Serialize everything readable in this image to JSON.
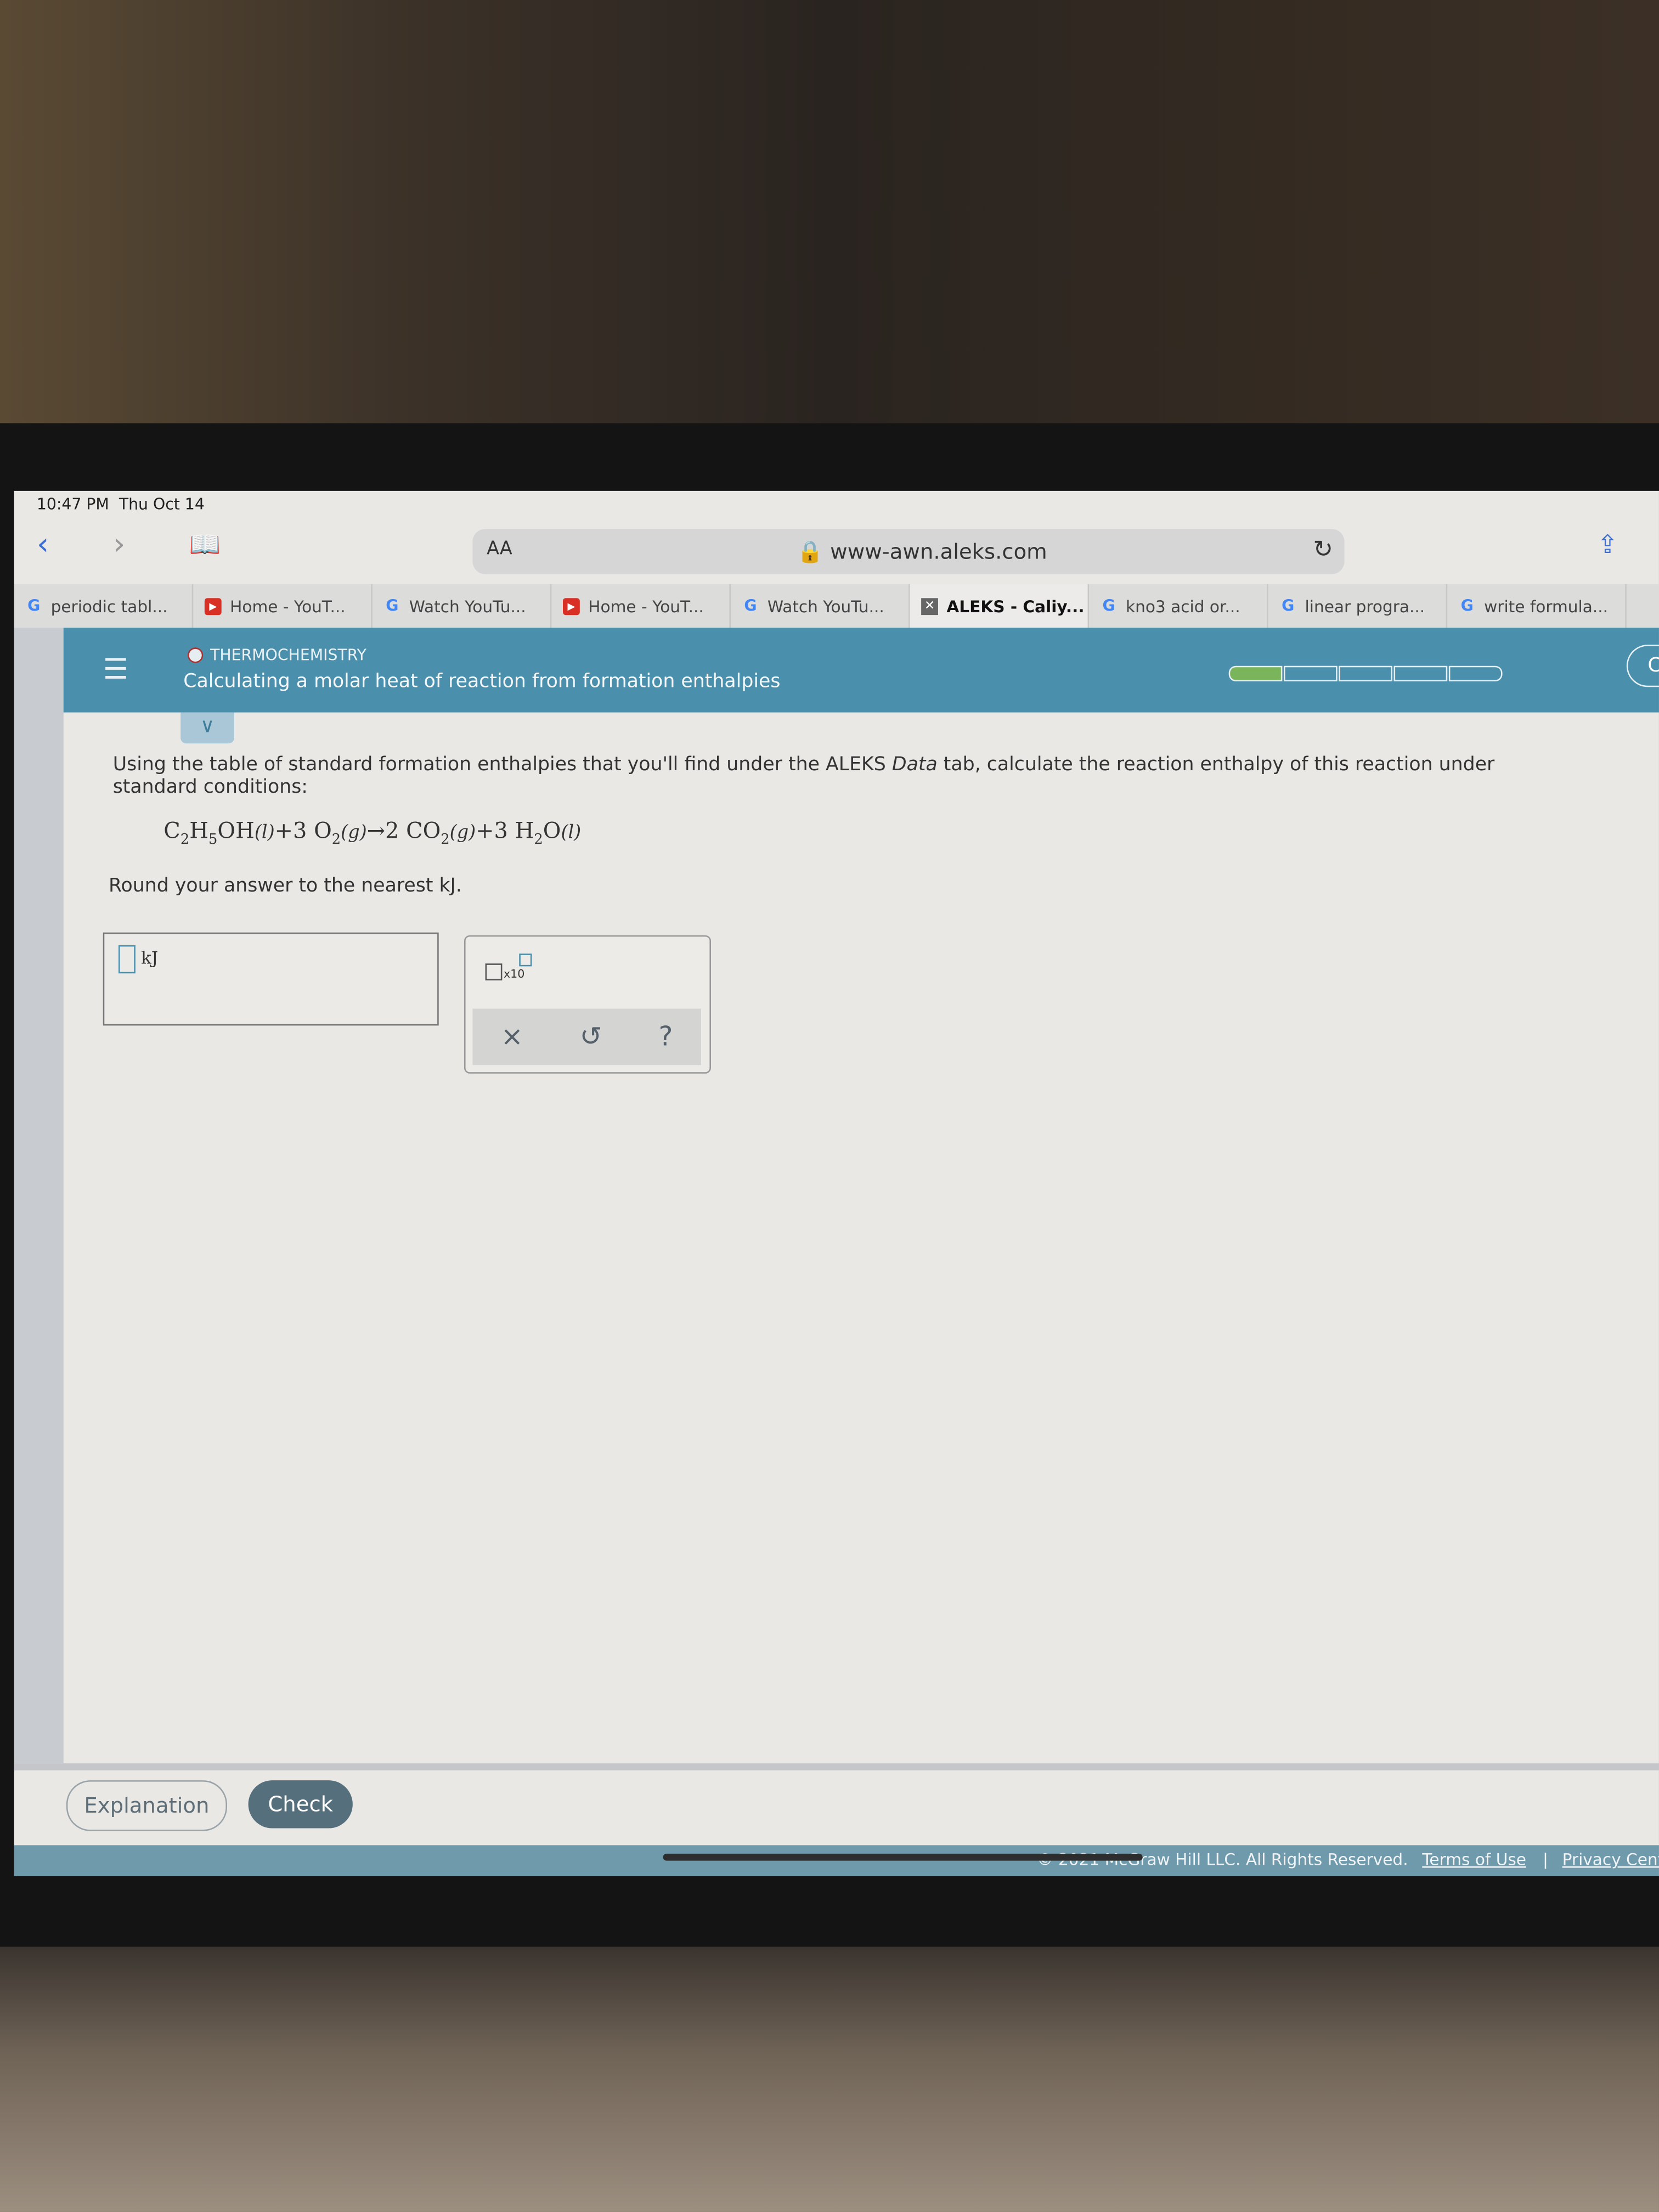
{
  "status_bar": {
    "time": "10:47 PM",
    "date": "Thu Oct 14"
  },
  "browser": {
    "text_size_label": "AA",
    "url": "www-awn.aleks.com",
    "tabs": [
      {
        "label": "periodic tabl...",
        "icon": "google-icon"
      },
      {
        "label": "Home - YouT...",
        "icon": "youtube-icon"
      },
      {
        "label": "Watch YouTu...",
        "icon": "google-icon"
      },
      {
        "label": "Home - YouT...",
        "icon": "youtube-icon"
      },
      {
        "label": "Watch YouTu...",
        "icon": "google-icon"
      },
      {
        "label": "ALEKS - Caliy...",
        "icon": "aleks-icon",
        "active": true
      },
      {
        "label": "kno3 acid or...",
        "icon": "google-icon"
      },
      {
        "label": "linear progra...",
        "icon": "google-icon"
      },
      {
        "label": "write formula...",
        "icon": "google-icon"
      }
    ]
  },
  "header": {
    "topic": "THERMOCHEMISTRY",
    "title": "Calculating a molar heat of reaction from formation enthalpies",
    "user": "Caliya",
    "progress": {
      "completed": 1,
      "total": 5
    },
    "color": "#4a8fab"
  },
  "question": {
    "text_before": "Using the table of standard formation enthalpies that you'll find under the ALEKS ",
    "text_italic": "Data",
    "text_after": " tab, calculate the reaction enthalpy of this reaction under standard conditions:",
    "equation": {
      "reactant1": "C",
      "r1a": "2",
      "r1b": "H",
      "r1c": "5",
      "r1d": "OH",
      "r1phase": "(l)",
      "plus1": "+3 O",
      "o2sub": "2",
      "o2phase": "(g)",
      "arrow": "→",
      "p1": "2 CO",
      "co2sub": "2",
      "co2phase": "(g)",
      "plus2": "+3 H",
      "h2sub": "2",
      "h2o": "O",
      "h2ophase": "(l)"
    },
    "instruction": "Round your answer to the nearest kJ."
  },
  "answer": {
    "value": "",
    "unit": "kJ"
  },
  "keypad": {
    "sci_label": "x10",
    "clear": "×",
    "undo": "↺",
    "help": "?"
  },
  "buttons": {
    "explanation": "Explanation",
    "check": "Check"
  },
  "footer": {
    "copyright": "© 2021 McGraw Hill LLC. All Rights Reserved.",
    "terms": "Terms of Use",
    "separator": "|",
    "privacy": "Privacy Center"
  }
}
